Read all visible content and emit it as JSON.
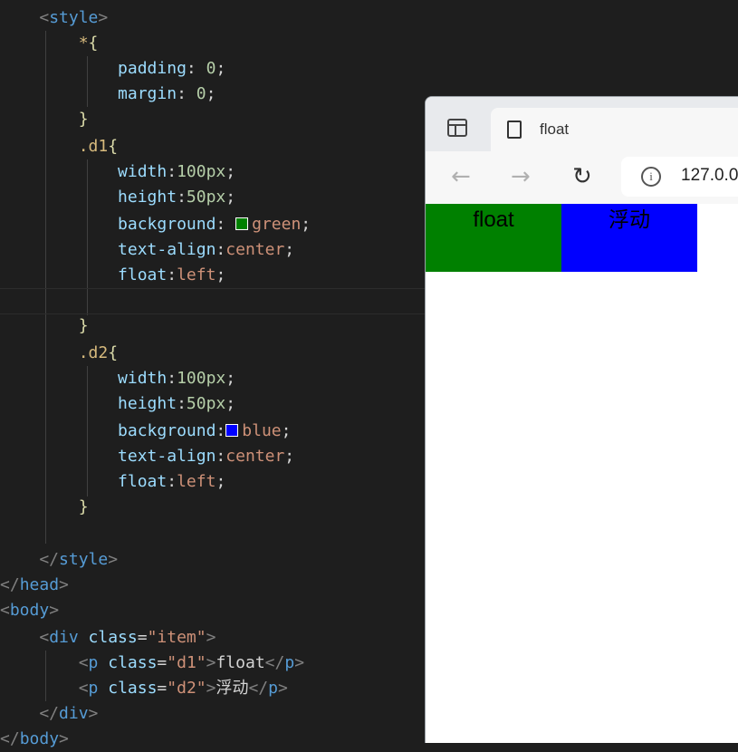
{
  "code": {
    "style_open": "style",
    "universal_selector": "*",
    "padding_prop": "padding",
    "padding_val": "0",
    "margin_prop": "margin",
    "margin_val": "0",
    "d1_selector": ".d1",
    "d2_selector": ".d2",
    "width_prop": "width",
    "width_val": "100px",
    "height_prop": "height",
    "height_val": "50px",
    "background_prop": "background",
    "d1_bg": "green",
    "d2_bg": "blue",
    "text_align_prop": "text-align",
    "text_align_val": "center",
    "float_prop": "float",
    "float_val": "left",
    "style_close": "style",
    "head_close": "head",
    "body_open": "body",
    "div_tag": "div",
    "class_attr": "class",
    "item_class": "\"item\"",
    "p_tag": "p",
    "d1_class": "\"d1\"",
    "d2_class": "\"d2\"",
    "d1_text": "float",
    "d2_text": "浮动",
    "body_close": "body"
  },
  "colors": {
    "green_swatch": "#008000",
    "blue_swatch": "#0000ff"
  },
  "browser": {
    "tab_title": "float",
    "url": "127.0.0",
    "back_icon": "←",
    "forward_icon": "→",
    "reload_icon": "↻",
    "info_icon": "i"
  },
  "rendered": {
    "d1": "float",
    "d2": "浮动"
  }
}
